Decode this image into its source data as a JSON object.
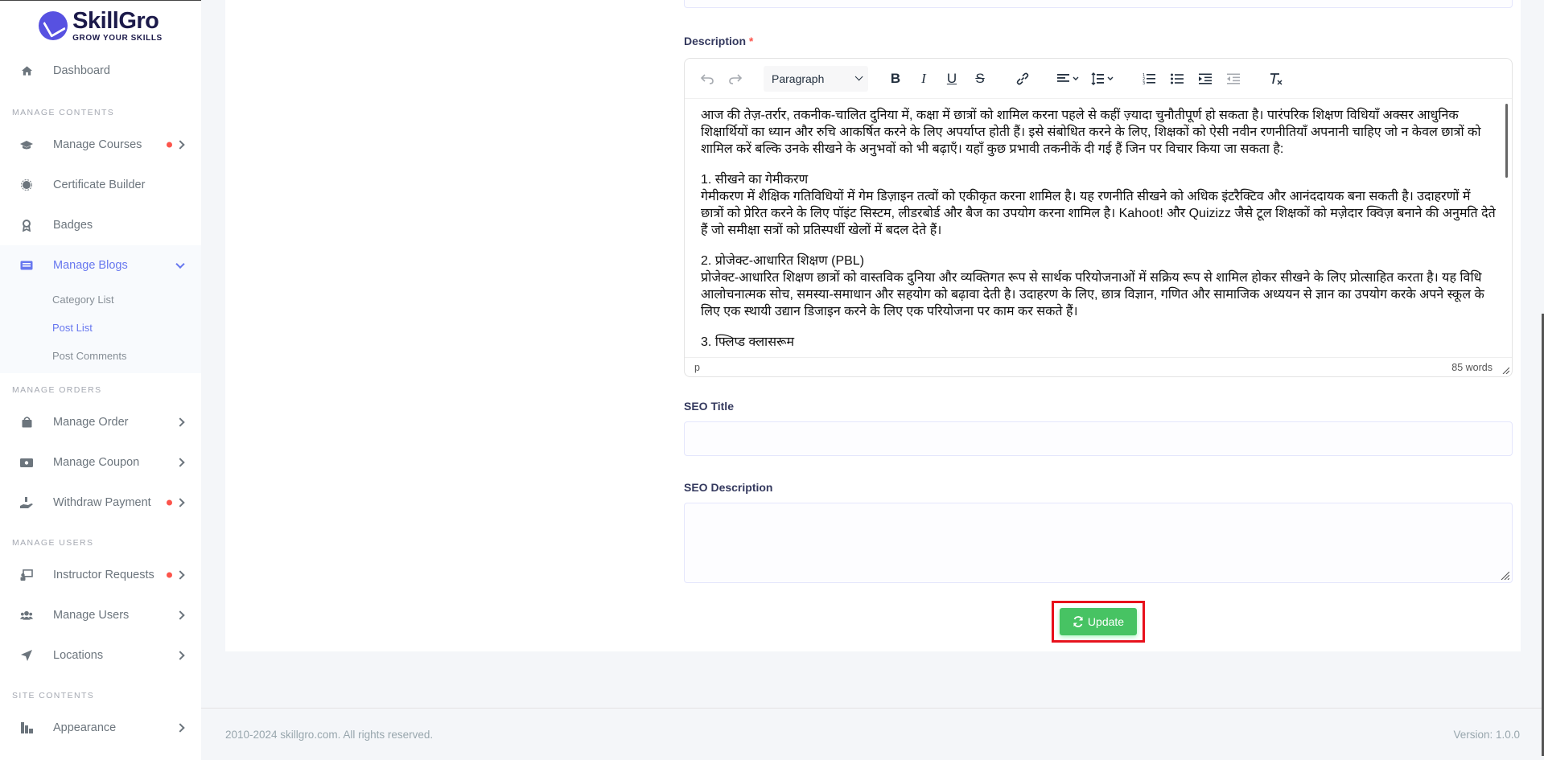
{
  "brand": {
    "name": "SkillGro",
    "tagline": "GROW YOUR SKILLS"
  },
  "sidebar": {
    "dashboard": "Dashboard",
    "sections": {
      "manage_contents": "MANAGE CONTENTS",
      "manage_orders": "MANAGE ORDERS",
      "manage_users": "MANAGE USERS",
      "site_contents": "SITE CONTENTS"
    },
    "items": {
      "manage_courses": "Manage Courses",
      "certificate_builder": "Certificate Builder",
      "badges": "Badges",
      "manage_blogs": "Manage Blogs",
      "manage_order": "Manage Order",
      "manage_coupon": "Manage Coupon",
      "withdraw_payment": "Withdraw Payment",
      "instructor_requests": "Instructor Requests",
      "manage_users": "Manage Users",
      "locations": "Locations",
      "appearance": "Appearance"
    },
    "blog_sub": {
      "category_list": "Category List",
      "post_list": "Post List",
      "post_comments": "Post Comments"
    }
  },
  "form": {
    "description_label": "Description",
    "required_mark": "*",
    "editor": {
      "format": "Paragraph",
      "paragraphs": [
        "आज की तेज़-तर्रार, तकनीक-चालित दुनिया में, कक्षा में छात्रों को शामिल करना पहले से कहीं ज़्यादा चुनौतीपूर्ण हो सकता है। पारंपरिक शिक्षण विधियाँ अक्सर आधुनिक शिक्षार्थियों का ध्यान और रुचि आकर्षित करने के लिए अपर्याप्त होती हैं। इसे संबोधित करने के लिए, शिक्षकों को ऐसी नवीन रणनीतियाँ अपनानी चाहिए जो न केवल छात्रों को शामिल करें बल्कि उनके सीखने के अनुभवों को भी बढ़ाएँ। यहाँ कुछ प्रभावी तकनीकें दी गई हैं जिन पर विचार किया जा सकता है:",
        "1. सीखने का गेमीकरण\nगेमीकरण में शैक्षिक गतिविधियों में गेम डिज़ाइन तत्वों को एकीकृत करना शामिल है। यह रणनीति सीखने को अधिक इंटरैक्टिव और आनंददायक बना सकती है। उदाहरणों में छात्रों को प्रेरित करने के लिए पॉइंट सिस्टम, लीडरबोर्ड और बैज का उपयोग करना शामिल है। Kahoot! और Quizizz जैसे टूल शिक्षकों को मज़ेदार क्विज़ बनाने की अनुमति देते हैं जो समीक्षा सत्रों को प्रतिस्पर्धी खेलों में बदल देते हैं।",
        "2. प्रोजेक्ट-आधारित शिक्षण (PBL)\nप्रोजेक्ट-आधारित शिक्षण छात्रों को वास्तविक दुनिया और व्यक्तिगत रूप से सार्थक परियोजनाओं में सक्रिय रूप से शामिल होकर सीखने के लिए प्रोत्साहित करता है। यह विधि आलोचनात्मक सोच, समस्या-समाधान और सहयोग को बढ़ावा देती है। उदाहरण के लिए, छात्र विज्ञान, गणित और सामाजिक अध्ययन से ज्ञान का उपयोग करके अपने स्कूल के लिए एक स्थायी उद्यान डिजाइन करने के लिए एक परियोजना पर काम कर सकते हैं।",
        "3. फ्लिप्ड क्लासरूम"
      ],
      "status_path": "p",
      "word_count": "85 words"
    },
    "seo_title_label": "SEO Title",
    "seo_title_value": "",
    "seo_description_label": "SEO Description",
    "seo_description_value": "",
    "update_button": "Update"
  },
  "footer": {
    "copyright": "2010-2024 skillgro.com. All rights reserved.",
    "version": "Version: 1.0.0"
  },
  "colors": {
    "accent": "#6777ef",
    "success": "#47c363",
    "danger": "#fc544b",
    "highlight_border": "#e8101b"
  }
}
